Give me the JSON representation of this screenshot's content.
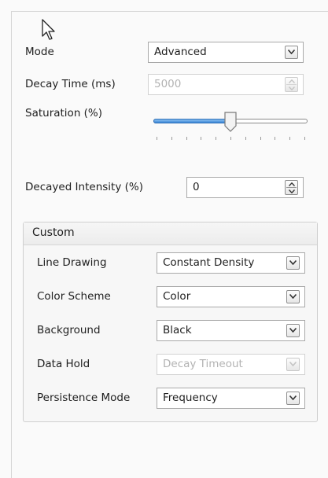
{
  "main": {
    "mode": {
      "label": "Mode",
      "value": "Advanced"
    },
    "decay_time": {
      "label": "Decay Time (ms)",
      "value": "5000"
    },
    "saturation": {
      "label": "Saturation (%)",
      "level_percent": 50
    },
    "decayed_intensity": {
      "label": "Decayed Intensity (%)",
      "value": "0"
    }
  },
  "custom": {
    "title": "Custom",
    "line_drawing": {
      "label": "Line Drawing",
      "value": "Constant Density"
    },
    "color_scheme": {
      "label": "Color Scheme",
      "value": "Color"
    },
    "background": {
      "label": "Background",
      "value": "Black"
    },
    "data_hold": {
      "label": "Data Hold",
      "value": "Decay Timeout"
    },
    "persistence_mode": {
      "label": "Persistence Mode",
      "value": "Frequency"
    }
  },
  "icons": {
    "cursor": "mouse-pointer-icon",
    "dropdown": "chevron-down-icon",
    "spinner": "spin-up-down-icon"
  },
  "colors": {
    "slider_fill": "#3a86d6",
    "disabled_text": "#b3b3b3"
  }
}
